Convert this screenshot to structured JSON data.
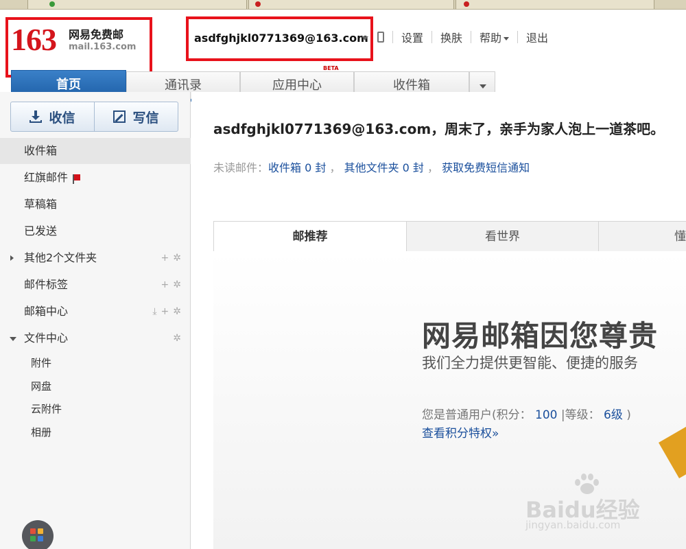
{
  "logo": {
    "number": "163",
    "name": "网易免费邮",
    "domain": "mail.163.com"
  },
  "account": {
    "email": "asdfghjkl0771369@163.com"
  },
  "toplinks": {
    "settings": "设置",
    "skin": "换肤",
    "help": "帮助",
    "logout": "退出"
  },
  "nav": {
    "tabs": [
      {
        "label": "首页"
      },
      {
        "label": "通讯录"
      },
      {
        "label": "应用中心",
        "badge": "BETA"
      },
      {
        "label": "收件箱"
      }
    ]
  },
  "sidebar": {
    "receive_label": "收信",
    "write_label": "写信",
    "folders": [
      {
        "label": "收件箱"
      },
      {
        "label": "红旗邮件"
      },
      {
        "label": "草稿箱"
      },
      {
        "label": "已发送"
      },
      {
        "label": "其他2个文件夹"
      },
      {
        "label": "邮件标签"
      },
      {
        "label": "邮箱中心"
      },
      {
        "label": "文件中心"
      }
    ],
    "subfolders": [
      {
        "label": "附件"
      },
      {
        "label": "网盘"
      },
      {
        "label": "云附件"
      },
      {
        "label": "相册"
      }
    ]
  },
  "main": {
    "greeting_email": "asdfghjkl0771369@163.com",
    "greeting_text": "，周末了，亲手为家人泡上一道茶吧。",
    "unread_label": "未读邮件：",
    "inbox_count": "收件箱 0 封",
    "other_count": "其他文件夹 0 封",
    "sms_link": "获取免费短信通知",
    "comma": "，",
    "tabs": [
      {
        "label": "邮推荐"
      },
      {
        "label": "看世界"
      },
      {
        "label": "懂"
      }
    ],
    "promo": {
      "title": "网易邮箱因您尊贵",
      "subtitle": "我们全力提供更智能、便捷的服务",
      "user_prefix": "您是普通用户(积分：",
      "points": "100",
      "level_label": "|等级：",
      "level": "6级",
      "user_suffix": ")",
      "privilege_link": "查看积分特权»"
    }
  },
  "watermark": {
    "text": "Baidu经验",
    "url": "jingyan.baidu.com"
  },
  "colors": {
    "brand_red": "#d4151c",
    "nav_blue": "#2a6db5",
    "link_blue": "#1a4f9c",
    "highlight_red": "#e8121b"
  }
}
